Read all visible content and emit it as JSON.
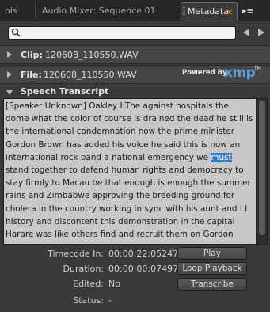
{
  "tabs": {
    "tab1": "ols",
    "tab2": "Audio Mixer: Sequence 01",
    "active": "Metadata",
    "close_glyph": "×",
    "menu_glyph": "▸≡"
  },
  "search": {
    "placeholder": "",
    "value": ""
  },
  "clip": {
    "label": "Clip:",
    "value": "120608_110550.WAV"
  },
  "file": {
    "label": "File:",
    "value": "120608_110550.WAV",
    "powered_by": "Powered By",
    "xmp_logo": "xmp",
    "tm": "TM"
  },
  "speech": {
    "label": "Speech Transcript"
  },
  "transcript": {
    "before": "[Speaker Unknown] Oakley I The against hospitals the dome what the color of course is drained the dead he still is the international condemnation now the prime minister Gordon Brown has added his voice he said this is now an international rock band a national emergency we ",
    "highlight": "must",
    "after": " stand together to defend human rights and democracy to stay firmly to Macau be that enough is enough the summer rains and Zimbabwe approving the breeding ground for cholera in the country working in sync with his aunt and I I history and discontent this demonstration in the capital Harare was like others find and recruit them on Gordon"
  },
  "fields": {
    "timecode_in": {
      "label": "Timecode In:",
      "value": "00:00:22:05247"
    },
    "duration": {
      "label": "Duration:",
      "value": "00:00:00:07497"
    },
    "edited": {
      "label": "Edited:",
      "value": "No"
    },
    "status": {
      "label": "Status:",
      "value": "-"
    }
  },
  "buttons": {
    "play": "Play",
    "loop_playback": "Loop Playback",
    "transcribe": "Transcribe"
  },
  "colors": {
    "panel_bg": "#3a3a3a",
    "transcript_bg": "#c8c8c8",
    "highlight": "#3778c4",
    "xmp_blue": "#5aa0dd",
    "close_orange": "#e08a2a"
  },
  "icons": {
    "search": "search-icon",
    "prev": "triangle-left-icon",
    "next": "triangle-right-icon",
    "collapsed": "triangle-right-icon",
    "expanded": "triangle-down-icon"
  }
}
